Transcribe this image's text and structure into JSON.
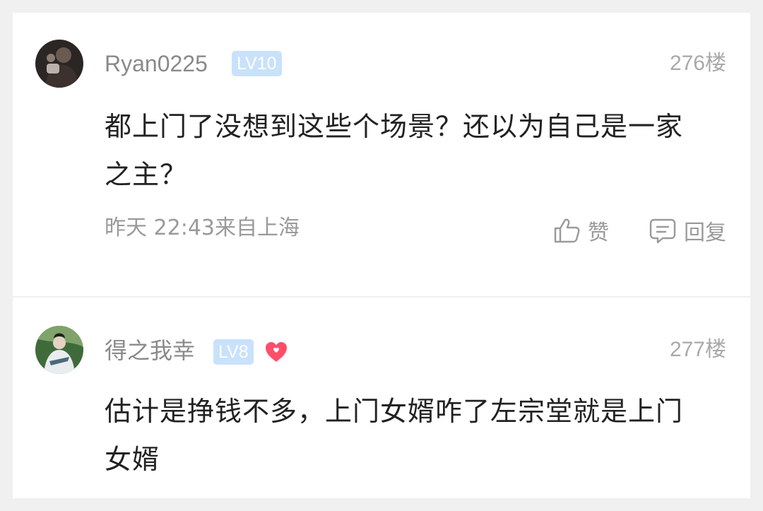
{
  "comments": [
    {
      "username": "Ryan0225",
      "level": "LV10",
      "floor": "276楼",
      "text": "都上门了没想到这些个场景？还以为自己是一家之主？",
      "meta": "昨天 22:43来自上海",
      "like_label": "赞",
      "reply_label": "回复"
    },
    {
      "username": "得之我幸",
      "level": "LV8",
      "floor": "277楼",
      "text": "估计是挣钱不多，上门女婿咋了左宗堂就是上门女婿"
    }
  ],
  "icons": {
    "like": "thumbs-up-icon",
    "reply": "comment-bubble-icon",
    "badge": "heart-icon"
  },
  "colors": {
    "level_badge": "#c9e2fb",
    "heart": "#ff4e6a",
    "muted_text": "#9a9a9a",
    "body_text": "#222222"
  }
}
